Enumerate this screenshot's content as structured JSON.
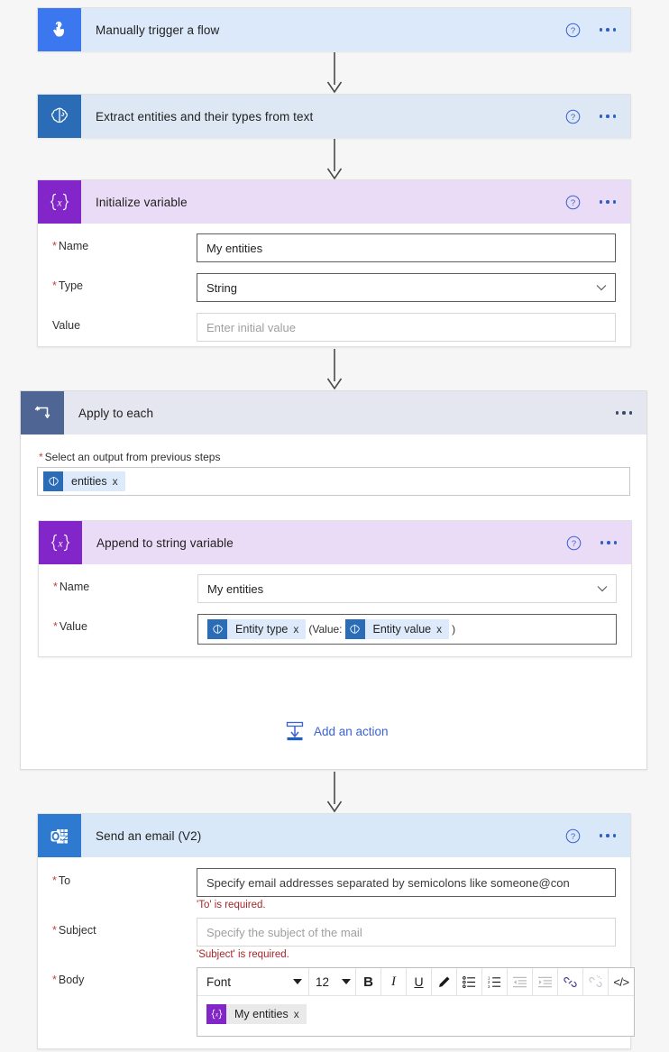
{
  "steps": {
    "trigger": {
      "title": "Manually trigger a flow",
      "icon": "touch-hand-icon",
      "header_color": "#dbe9fb",
      "tile_color": "#3b78ef"
    },
    "extract": {
      "title": "Extract entities and their types from text",
      "icon": "ai-brain-icon",
      "header_color": "#dde8f4",
      "tile_color": "#2b6cb6"
    },
    "init_variable": {
      "title": "Initialize variable",
      "icon": "variable-braces-icon",
      "header_color": "#eadcf7",
      "tile_color": "#8225c9",
      "fields": [
        {
          "label": "Name",
          "required": true,
          "value": "My entities",
          "placeholder": "",
          "type": "text",
          "filled": true
        },
        {
          "label": "Type",
          "required": true,
          "value": "String",
          "placeholder": "",
          "type": "dropdown",
          "filled": true
        },
        {
          "label": "Value",
          "required": false,
          "value": "",
          "placeholder": "Enter initial value",
          "type": "text",
          "filled": false
        }
      ]
    },
    "apply_to_each": {
      "title": "Apply to each",
      "icon": "loop-arrow-icon",
      "header_color": "#e4e7f0",
      "tile_color": "#4f6694",
      "select_label": "Select an output from previous steps",
      "select_required": true,
      "select_token": {
        "text": "entities",
        "icon": "ai-brain-icon",
        "remove": "x"
      },
      "add_action": {
        "label": "Add an action",
        "icon": "add-action-insert-icon",
        "color": "#3b62d4"
      }
    },
    "append_variable": {
      "title": "Append to string variable",
      "icon": "variable-braces-icon",
      "header_color": "#eadcf7",
      "tile_color": "#8225c9",
      "name_label": "Name",
      "name_value": "My entities",
      "value_label": "Value",
      "value_tokens": [
        {
          "text": "Entity type",
          "icon": "ai-brain-icon",
          "remove": "x"
        },
        {
          "text": "Entity value",
          "icon": "ai-brain-icon",
          "remove": "x"
        }
      ],
      "value_prefix_text": "(Value:",
      "value_suffix_text": ")"
    },
    "send_email": {
      "title": "Send an email (V2)",
      "icon": "outlook-icon",
      "header_color": "#d9e8f8",
      "tile_color": "#2e7ad1",
      "to_label": "To",
      "to_placeholder": "Specify email addresses separated by semicolons like someone@con",
      "to_error": "'To' is required.",
      "subject_label": "Subject",
      "subject_placeholder": "Specify the subject of the mail",
      "subject_error": "'Subject' is required.",
      "body_label": "Body",
      "toolbar": {
        "font_label": "Font",
        "size_label": "12",
        "bold": "B",
        "italic": "I",
        "underline": "U",
        "code": "</>"
      },
      "body_token": {
        "text": "My entities",
        "icon": "variable-braces-icon",
        "remove": "x"
      }
    }
  },
  "common": {
    "help_icon": "help-circle-icon",
    "more_icon": "more-ellipsis-icon",
    "required_mark": "*",
    "accent_blue": "#2e5fc3",
    "error_red": "#a4262c",
    "purple": "#8225c9"
  }
}
